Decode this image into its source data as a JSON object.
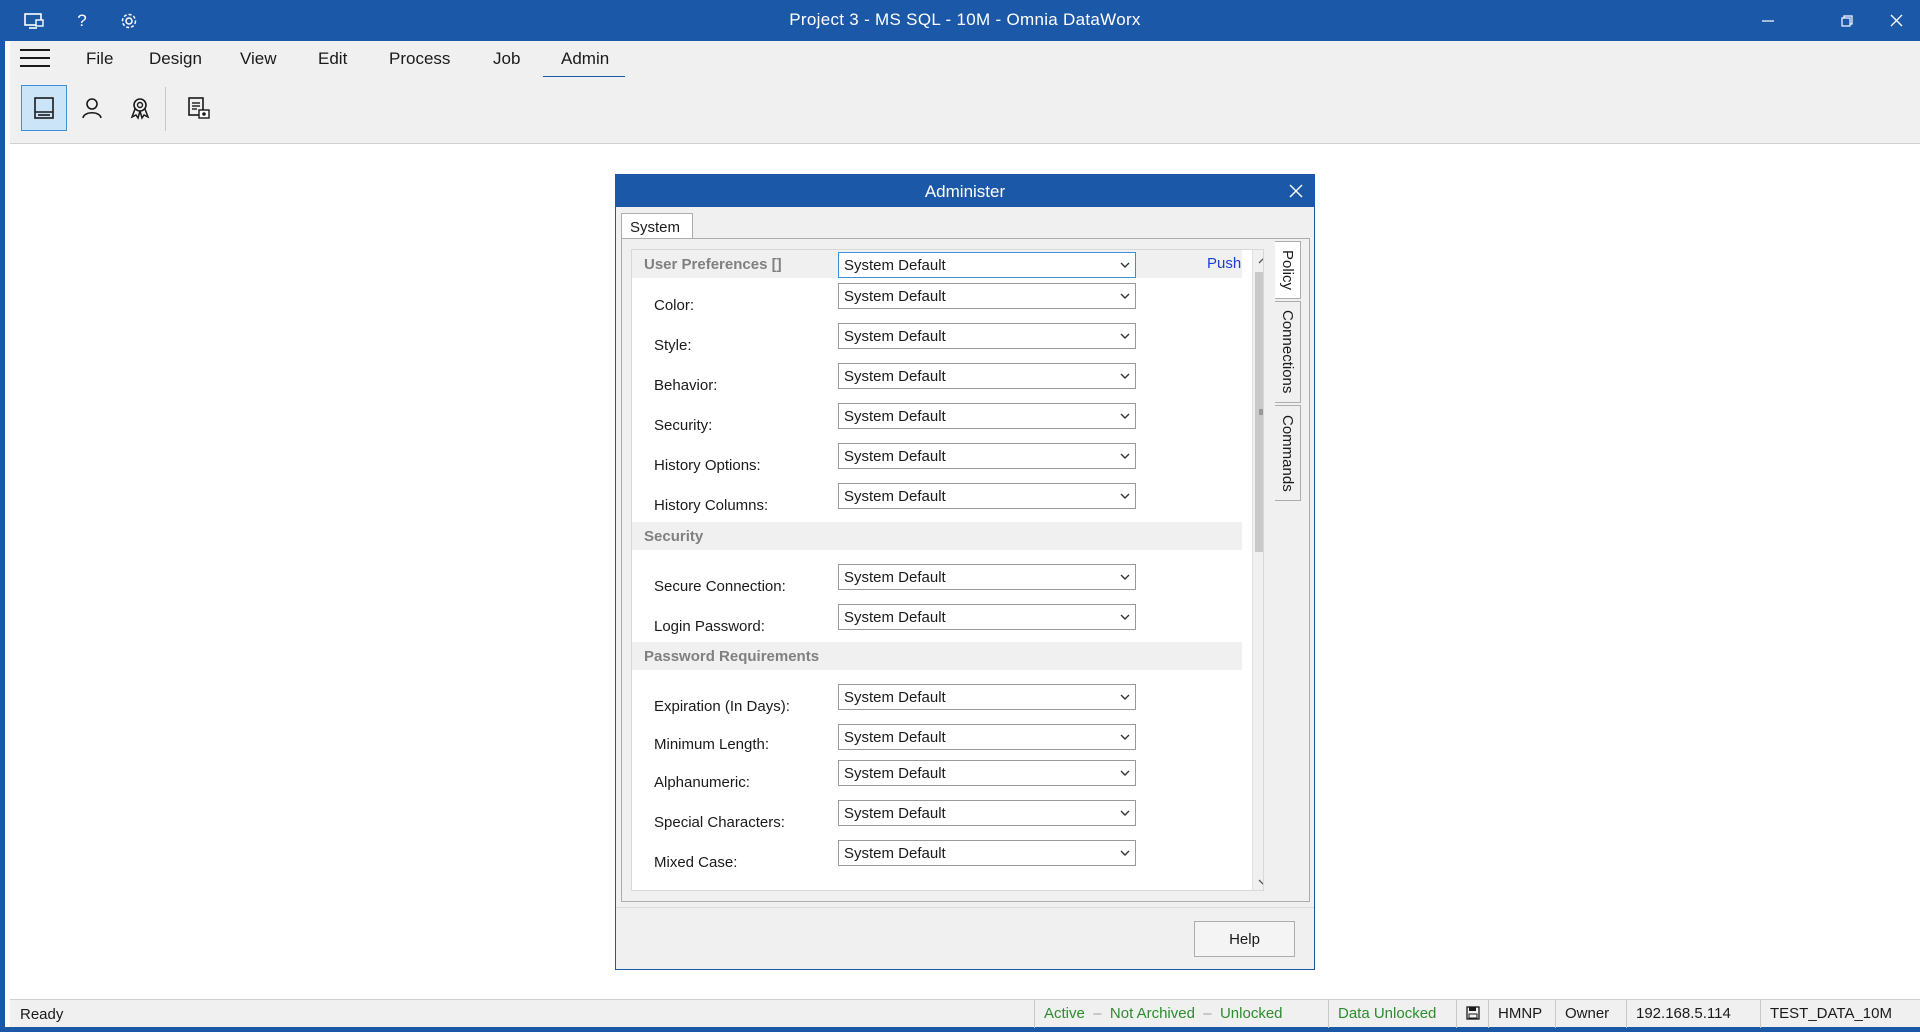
{
  "app": {
    "title": "Project 3 - MS SQL - 10M - Omnia DataWorx"
  },
  "menu": {
    "items": [
      "File",
      "Design",
      "View",
      "Edit",
      "Process",
      "Job",
      "Admin"
    ],
    "active": "Admin"
  },
  "toolbar": {
    "buttons": [
      "system-admin-icon",
      "user-icon",
      "award-icon",
      "document-settings-icon"
    ]
  },
  "dialog": {
    "title": "Administer",
    "tab": "System",
    "push_label": "Push",
    "side_tabs": [
      "Policy",
      "Connections",
      "Commands"
    ],
    "help_label": "Help",
    "sections": {
      "user_prefs": {
        "header": "User Preferences []",
        "value": "System Default",
        "rows": [
          {
            "label": "Color:",
            "value": "System Default"
          },
          {
            "label": "Style:",
            "value": "System Default"
          },
          {
            "label": "Behavior:",
            "value": "System Default"
          },
          {
            "label": "Security:",
            "value": "System Default"
          },
          {
            "label": "History Options:",
            "value": "System Default"
          },
          {
            "label": "History Columns:",
            "value": "System Default"
          }
        ]
      },
      "security": {
        "header": "Security",
        "rows": [
          {
            "label": "Secure Connection:",
            "value": "System Default"
          },
          {
            "label": "Login Password:",
            "value": "System Default"
          }
        ]
      },
      "password": {
        "header": "Password Requirements",
        "rows": [
          {
            "label": "Expiration (In Days):",
            "value": "System Default"
          },
          {
            "label": "Minimum Length:",
            "value": "System Default"
          },
          {
            "label": "Alphanumeric:",
            "value": "System Default"
          },
          {
            "label": "Special Characters:",
            "value": "System Default"
          },
          {
            "label": "Mixed Case:",
            "value": "System Default"
          }
        ]
      }
    }
  },
  "status": {
    "ready": "Ready",
    "active": "Active",
    "not_archived": "Not Archived",
    "unlocked": "Unlocked",
    "data_unlocked": "Data Unlocked",
    "hmnp": "HMNP",
    "owner": "Owner",
    "ip": "192.168.5.114",
    "db": "TEST_DATA_10M"
  },
  "colors": {
    "accent": "#1b58a8",
    "status_green": "#2e8b2e",
    "link_blue": "#1a3fd6"
  }
}
